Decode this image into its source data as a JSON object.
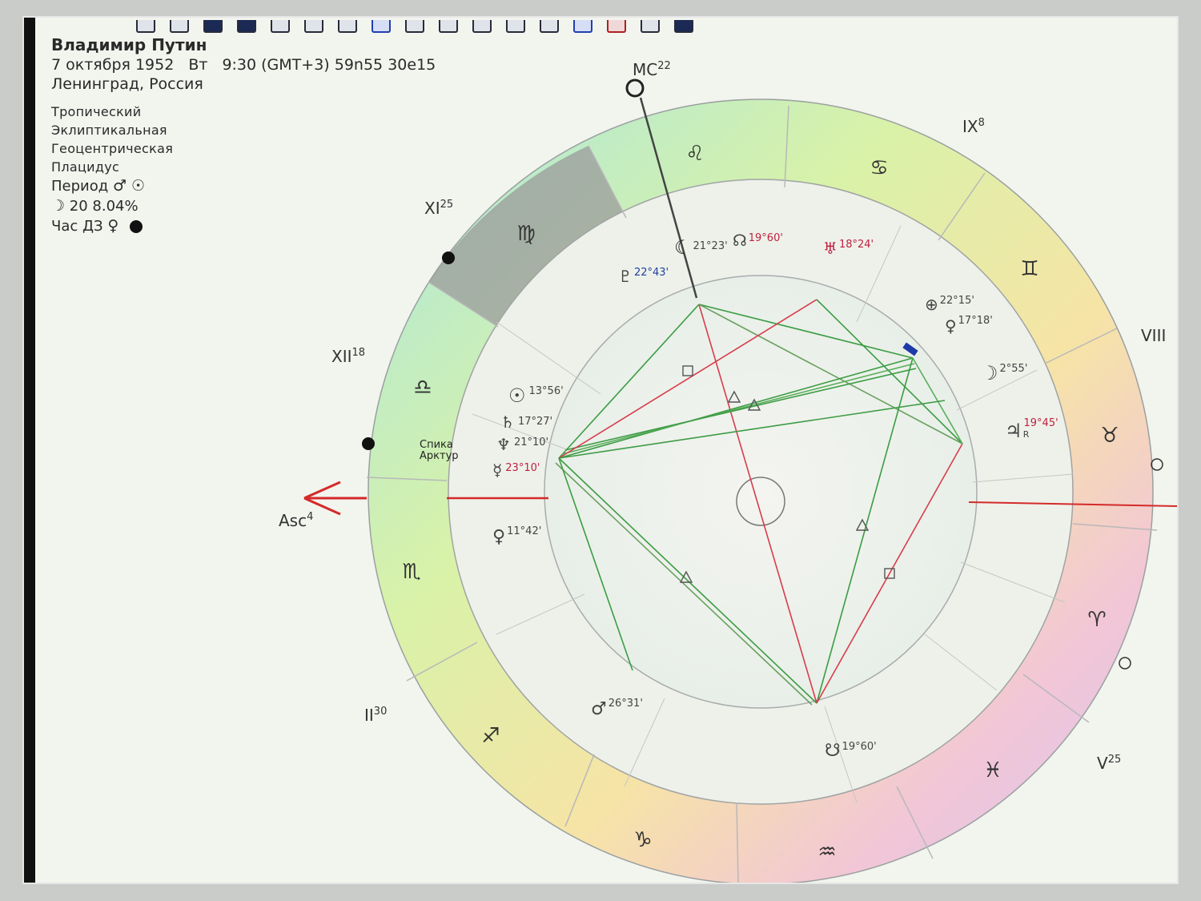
{
  "toolbar": {
    "icons": [
      "toolbar-icon-1",
      "toolbar-icon-2",
      "toolbar-icon-3",
      "toolbar-icon-4",
      "toolbar-icon-5",
      "toolbar-icon-6",
      "toolbar-icon-7",
      "toolbar-icon-8",
      "toolbar-icon-9",
      "toolbar-icon-10",
      "toolbar-icon-11",
      "toolbar-icon-12",
      "toolbar-icon-13",
      "toolbar-icon-14",
      "toolbar-icon-15",
      "toolbar-icon-16",
      "toolbar-icon-17",
      "toolbar-icon-18"
    ]
  },
  "info": {
    "name": "Владимир Путин",
    "date": "7 октября 1952",
    "weekday": "Вт",
    "time": "9:30 (GMT+3)",
    "latitude": "59n55",
    "longitude": "30e15",
    "place": "Ленинград, Россия",
    "zodiac": "Тропический",
    "coords": "Эклиптикальная",
    "center": "Геоцентрическая",
    "houses": "Плацидус",
    "period_label": "Период",
    "period_symbols": "♂ ☉",
    "moon_day_symbol": "☽",
    "moon_day": "20 8.04%",
    "hour_label": "Час ДЗ",
    "hour_symbol": "♀"
  },
  "houses": {
    "mc": {
      "name": "MC",
      "deg": "22"
    },
    "asc": {
      "name": "Asc",
      "deg": "4"
    },
    "ix": {
      "name": "IX",
      "deg": "8"
    },
    "viii": {
      "name": "VIII",
      "deg": ""
    },
    "xi": {
      "name": "XI",
      "deg": "25"
    },
    "xii": {
      "name": "XII",
      "deg": "18"
    },
    "ii": {
      "name": "II",
      "deg": "30"
    },
    "v": {
      "name": "V",
      "deg": "25"
    }
  },
  "signs": {
    "leo": "♌",
    "cancer": "♋",
    "gemini": "♊",
    "virgo": "♍",
    "libra": "♎",
    "scorpio": "♏",
    "sagittarius": "♐",
    "capricorn": "♑",
    "aquarius": "♒",
    "pisces": "♓",
    "aries": "♈",
    "taurus": "♉"
  },
  "planets": {
    "moon_node": {
      "glyph": "☾",
      "deg": "21°23'"
    },
    "node2": {
      "glyph": "☊",
      "deg": "19°60'"
    },
    "uranus": {
      "glyph": "♅",
      "deg": "18°24'"
    },
    "pluto": {
      "glyph": "♇",
      "deg": "22°43'"
    },
    "fortune": {
      "glyph": "⊕",
      "deg": "22°15'"
    },
    "venus2": {
      "glyph": "♀",
      "deg": "17°18'"
    },
    "moon": {
      "glyph": "☽",
      "deg": "2°55'"
    },
    "jupiter": {
      "glyph": "♃",
      "deg": "19°45'",
      "retro": "R"
    },
    "sun": {
      "glyph": "☉",
      "deg": "13°56'"
    },
    "saturn": {
      "glyph": "♄",
      "deg": "17°27'"
    },
    "neptune": {
      "glyph": "♆",
      "deg": "21°10'"
    },
    "mercury": {
      "glyph": "☿",
      "deg": "23°10'"
    },
    "venus": {
      "glyph": "♀",
      "deg": "11°42'"
    },
    "mars": {
      "glyph": "♂",
      "deg": "26°31'"
    },
    "south_node": {
      "glyph": "☋",
      "deg": "19°60'"
    }
  },
  "stars": {
    "spica": "Спика",
    "arcturus": "Арктур"
  },
  "colors": {
    "asc_arrow": "#d42a2a",
    "aspect_red": "#d83c4c",
    "aspect_green": "#3c9c44"
  }
}
